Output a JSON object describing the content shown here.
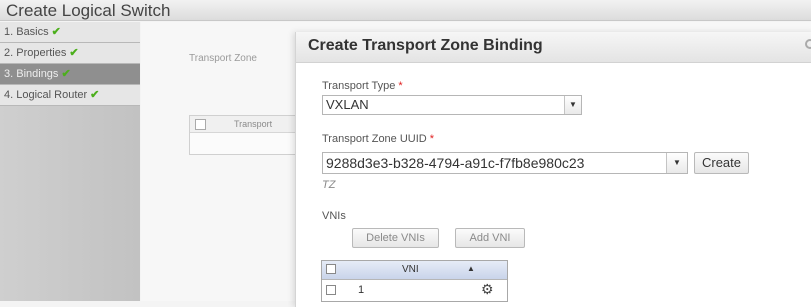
{
  "wizard": {
    "title": "Create Logical Switch",
    "steps": [
      {
        "label": "1. Basics",
        "done": true
      },
      {
        "label": "2. Properties",
        "done": true
      },
      {
        "label": "3. Bindings",
        "done": true,
        "active": true
      },
      {
        "label": "4. Logical Router",
        "done": true
      }
    ],
    "background_label": "Transport Zone",
    "background_table_header": "Transport"
  },
  "dialog": {
    "title": "Create Transport Zone Binding",
    "transport_type": {
      "label": "Transport Type",
      "required_mark": "*",
      "value": "VXLAN"
    },
    "transport_zone_uuid": {
      "label": "Transport Zone UUID",
      "required_mark": "*",
      "value": "9288d3e3-b328-4794-a91c-f7fb8e980c23",
      "create_button": "Create",
      "hint": "TZ"
    },
    "vnis": {
      "label": "VNIs",
      "delete_button": "Delete VNIs",
      "add_button": "Add VNI",
      "column_header": "VNI",
      "sort_indicator": "▲",
      "rows": [
        {
          "value": "1"
        }
      ]
    }
  },
  "icons": {
    "check": "check-icon",
    "close": "close-icon",
    "gear": "gear-icon"
  },
  "colors": {
    "check_green": "#4caf1c",
    "required_red": "#e02020",
    "active_step_bg": "#8f8f8f"
  }
}
